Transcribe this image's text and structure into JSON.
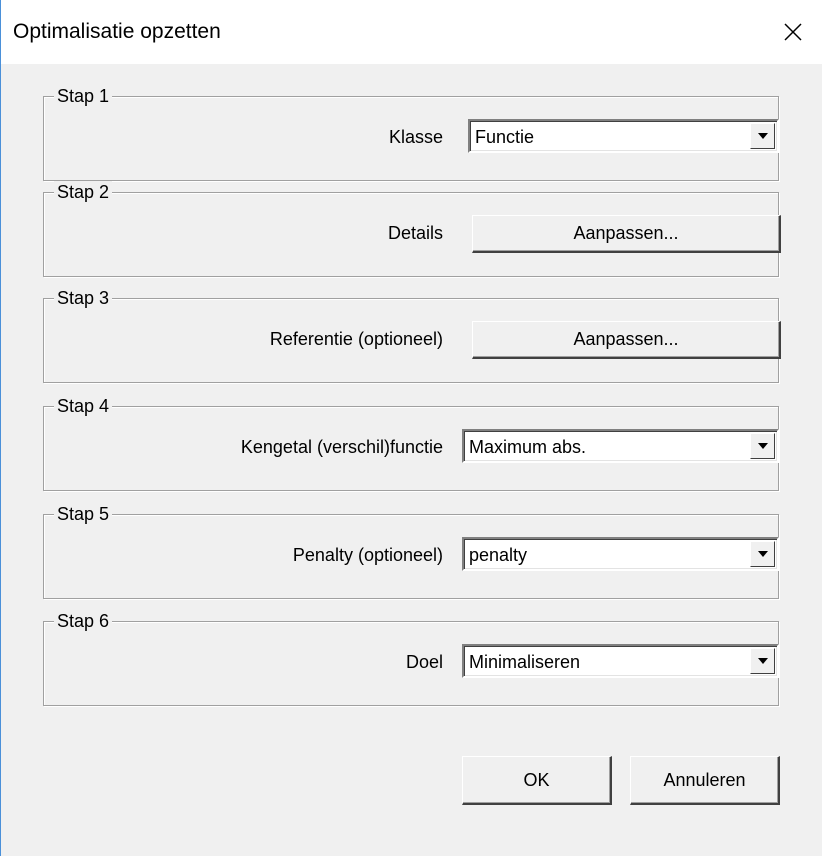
{
  "window": {
    "title": "Optimalisatie opzetten",
    "close_icon": "close-icon"
  },
  "steps": [
    {
      "legend": "Stap 1",
      "label": "Klasse",
      "control": "combo",
      "value": "Functie"
    },
    {
      "legend": "Stap 2",
      "label": "Details",
      "control": "button",
      "value": "Aanpassen..."
    },
    {
      "legend": "Stap 3",
      "label": "Referentie (optioneel)",
      "control": "button",
      "value": "Aanpassen..."
    },
    {
      "legend": "Stap 4",
      "label": "Kengetal (verschil)functie",
      "control": "combo",
      "value": "Maximum abs."
    },
    {
      "legend": "Stap 5",
      "label": "Penalty (optioneel)",
      "control": "combo",
      "value": "penalty"
    },
    {
      "legend": "Stap 6",
      "label": "Doel",
      "control": "combo",
      "value": "Minimaliseren"
    }
  ],
  "footer": {
    "ok_label": "OK",
    "cancel_label": "Annuleren"
  }
}
